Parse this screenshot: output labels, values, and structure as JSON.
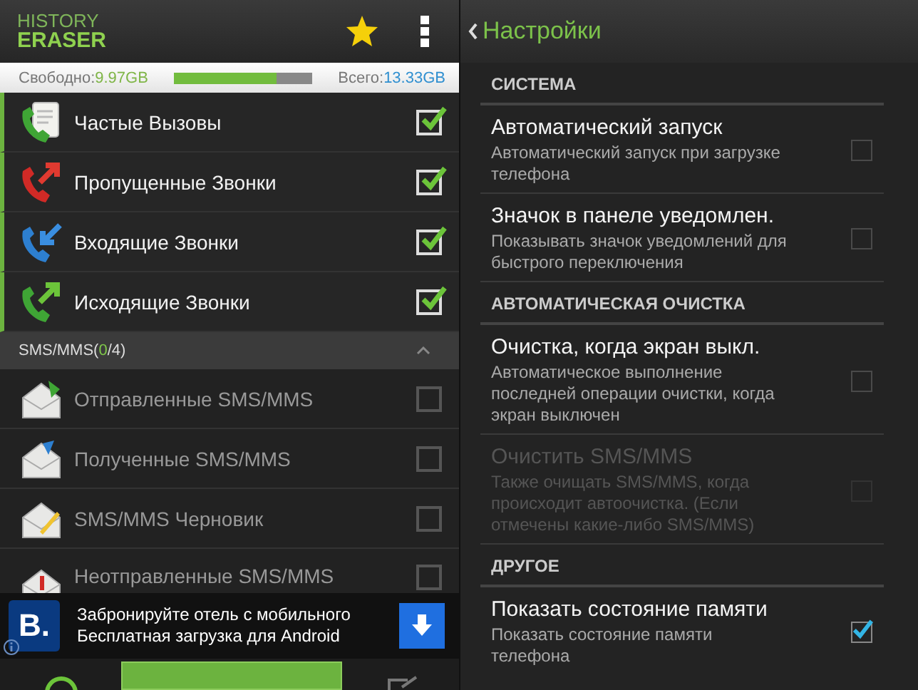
{
  "app": {
    "logo_top": "HISTORY",
    "logo_bottom": "ERASER",
    "favorite": true
  },
  "storage": {
    "free_label": "Свободно:",
    "free_value": "9.97GB",
    "level": 0.74,
    "total_label": "Всего:",
    "total_value": "13.33GB"
  },
  "call_items": [
    {
      "label": "Частые Вызовы",
      "checked": true
    },
    {
      "label": "Пропущенные Звонки",
      "checked": true
    },
    {
      "label": "Входящие Звонки",
      "checked": true
    },
    {
      "label": "Исходящие Звонки",
      "checked": true
    }
  ],
  "sms_section": {
    "prefix": "SMS/MMS(",
    "count": "0",
    "suffix": "/4)",
    "expanded": true
  },
  "sms_items": [
    {
      "label": "Отправленные SMS/MMS",
      "checked": false
    },
    {
      "label": "Полученные SMS/MMS",
      "checked": false
    },
    {
      "label": "SMS/MMS Черновик",
      "checked": false
    },
    {
      "label": "Неотправленные SMS/MMS",
      "checked": false
    }
  ],
  "ad": {
    "logo": "B.",
    "title": "Забронируйте отель с мобильного",
    "subtitle": "Бесплатная загрузка для Android"
  },
  "settings": {
    "title": "Настройки",
    "sections": [
      {
        "title": "СИСТЕМА",
        "items": [
          {
            "title": "Автоматический запуск",
            "summary": "Автоматический запуск при загрузке телефона",
            "checked": false,
            "disabled": false
          },
          {
            "title": "Значок в панеле уведомлен.",
            "summary": "Показывать значок уведомлений для быстрого переключения",
            "checked": false,
            "disabled": false
          }
        ]
      },
      {
        "title": "АВТОМАТИЧЕСКАЯ ОЧИСТКА",
        "items": [
          {
            "title": "Очистка, когда экран выкл.",
            "summary": "Автоматическое выполнение последней операции очистки, когда экран выключен",
            "checked": false,
            "disabled": false
          },
          {
            "title": "Очистить SMS/MMS",
            "summary": "Также очищать SMS/MMS, когда происходит автоочистка. (Если отмечены какие-либо SMS/MMS)",
            "checked": false,
            "disabled": true
          }
        ]
      },
      {
        "title": "ДРУГОЕ",
        "items": [
          {
            "title": "Показать состояние памяти",
            "summary": "Показать состояние памяти телефона",
            "checked": true,
            "disabled": false
          }
        ]
      }
    ]
  }
}
